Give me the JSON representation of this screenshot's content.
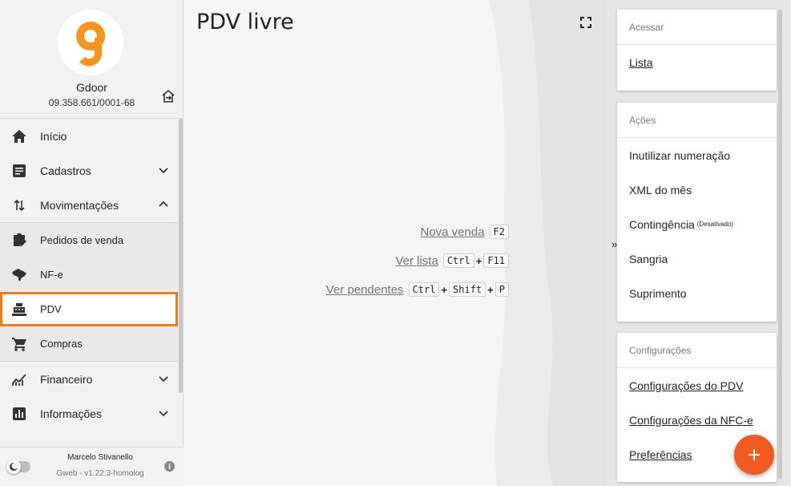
{
  "colors": {
    "accent": "#f07a1e",
    "fab": "#f15a22",
    "brand": "#f7941d"
  },
  "sidebar": {
    "company": "Gdoor",
    "cnpj": "09.358.661/0001-68",
    "items": [
      {
        "label": "Início",
        "icon": "home-icon"
      },
      {
        "label": "Cadastros",
        "icon": "document-icon"
      },
      {
        "label": "Movimentações",
        "icon": "swap-vertical-icon"
      }
    ],
    "subitems": [
      {
        "label": "Pedidos de venda",
        "icon": "clipboard-edit-icon"
      },
      {
        "label": "NF-e",
        "icon": "brazil-map-icon"
      },
      {
        "label": "PDV",
        "icon": "cash-register-icon"
      },
      {
        "label": "Compras",
        "icon": "cart-icon"
      }
    ],
    "bottom_items": [
      {
        "label": "Financeiro",
        "icon": "finance-chart-icon"
      },
      {
        "label": "Informações",
        "icon": "bar-chart-icon"
      }
    ],
    "user": "Marcelo Stivanello",
    "version": "Gweb - v1.22.3-homolog"
  },
  "main": {
    "title": "PDV livre",
    "shortcuts": [
      {
        "label": "Nova venda",
        "keys": [
          "F2"
        ]
      },
      {
        "label": "Ver lista",
        "keys": [
          "Ctrl",
          "F11"
        ]
      },
      {
        "label": "Ver pendentes",
        "keys": [
          "Ctrl",
          "Shift",
          "P"
        ]
      }
    ],
    "plus_sign": "+",
    "collapse_glyph": "»"
  },
  "panel": {
    "acessar": {
      "header": "Acessar",
      "items": [
        "Lista"
      ]
    },
    "acoes": {
      "header": "Ações",
      "items": [
        "Inutilizar numeração",
        "XML do mês",
        "Contingência",
        "Sangria",
        "Suprimento"
      ],
      "contingencia_note": "(Desativado)"
    },
    "config": {
      "header": "Configurações",
      "items": [
        "Configurações do PDV",
        "Configurações da NFC-e",
        "Preferências"
      ]
    }
  }
}
